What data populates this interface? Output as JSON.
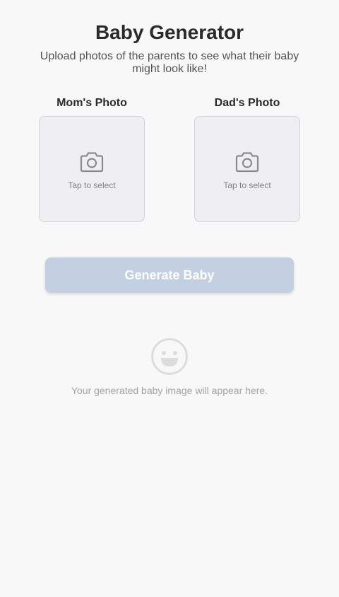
{
  "header": {
    "title": "Baby Generator",
    "subtitle": "Upload photos of the parents to see what their baby might look like!"
  },
  "mom_photo": {
    "label": "Mom's Photo",
    "icon": "camera-icon",
    "hint": "Tap to select"
  },
  "dad_photo": {
    "label": "Dad's Photo",
    "icon": "camera-icon",
    "hint": "Tap to select"
  },
  "generate": {
    "label": "Generate Baby"
  },
  "result": {
    "icon": "smiley-icon",
    "placeholder": "Your generated baby image will appear here."
  },
  "colors": {
    "background": "#f8f8f8",
    "button_disabled": "#c2d0e2",
    "photo_box": "#efeff3",
    "icon_gray": "#8a8a90"
  }
}
